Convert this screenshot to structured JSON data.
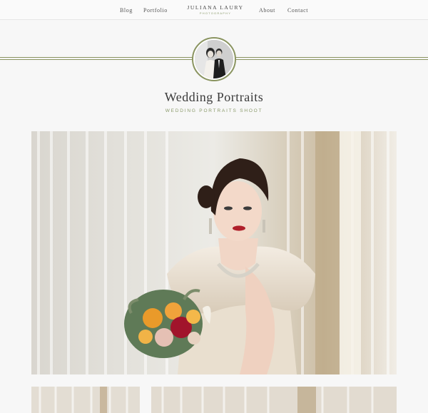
{
  "nav": {
    "left": [
      "Blog",
      "Portfolio"
    ],
    "right": [
      "About",
      "Contact"
    ],
    "brand_name": "JULIANA LAURY",
    "brand_sub": "PHOTOGRAPHY"
  },
  "page": {
    "title": "Wedding Portraits",
    "subtitle": "WEDDING PORTRAITS SHOOT"
  },
  "colors": {
    "accent": "#8a9460",
    "subtitle": "#8a9a6a",
    "background": "#f7f7f7"
  }
}
